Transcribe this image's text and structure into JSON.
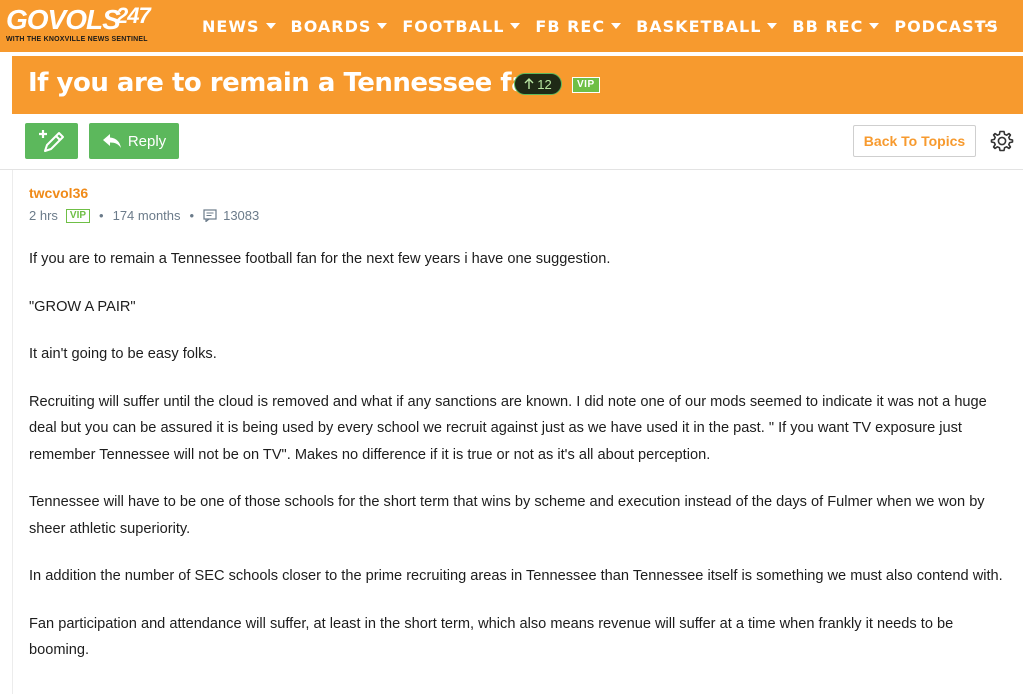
{
  "nav": {
    "logo_main": "GOVOLS",
    "logo_num": "247",
    "logo_sub_prefix": "WITH THE",
    "logo_sub": "KNOXVILLE NEWS SENTINEL",
    "items": [
      {
        "label": "NEWS",
        "has_caret": true
      },
      {
        "label": "BOARDS",
        "has_caret": true
      },
      {
        "label": "FOOTBALL",
        "has_caret": true
      },
      {
        "label": "FB REC",
        "has_caret": true
      },
      {
        "label": "BASKETBALL",
        "has_caret": true
      },
      {
        "label": "BB REC",
        "has_caret": true
      },
      {
        "label": "PODCASTS",
        "has_caret": false
      }
    ],
    "more": "···"
  },
  "thread": {
    "title": "If you are to remain a Tennessee fan.",
    "vote_count": "12",
    "vip": "VIP"
  },
  "toolbar": {
    "reply_label": "Reply",
    "back_label": "Back To Topics"
  },
  "post": {
    "author": "twcvol36",
    "time": "2 hrs",
    "vip": "VIP",
    "tenure": "174 months",
    "post_count": "13083",
    "paragraphs": [
      "If you are to remain a Tennessee football fan for the next few years i have one suggestion.",
      "\"GROW A PAIR\"",
      "It ain't going to be easy folks.",
      "Recruiting will suffer until the cloud is removed and what if any sanctions are known. I did note one of our mods seemed to indicate it was not a huge deal but you can be assured it is being used by every school we recruit against just as we have used it in the past. \" If you want TV exposure just remember Tennessee will not be on TV\". Makes no difference if it is true or not as it's all about perception.",
      "Tennessee will have to be one of those schools for the short term that wins by scheme and execution instead of the days of Fulmer when we won by sheer athletic superiority.",
      "In addition the number of SEC schools closer to the prime recruiting areas in Tennessee than Tennessee itself is something we must also contend with.",
      "Fan participation and attendance will suffer, at least in the short term, which also means revenue will suffer at a time when frankly it needs to be booming."
    ]
  },
  "colors": {
    "brand_orange": "#f79a2e",
    "action_green": "#5cb85c",
    "vip_green": "#6fbf46"
  }
}
